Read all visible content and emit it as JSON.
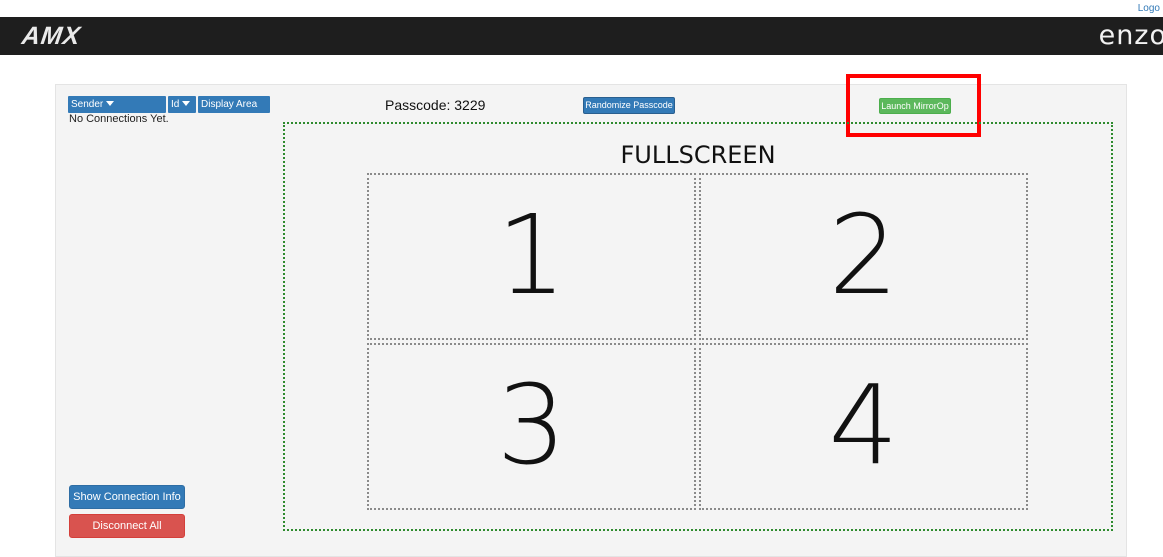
{
  "header": {
    "logout_label": "Logo",
    "left_logo": "AMX",
    "right_logo": "enzo",
    "bar_color": "#1e1e1e"
  },
  "connections": {
    "columns": [
      {
        "label": "Sender",
        "sortable": true
      },
      {
        "label": "Id",
        "sortable": true
      },
      {
        "label": "Display Area",
        "sortable": false
      }
    ],
    "empty_message": "No Connections Yet."
  },
  "passcode": {
    "label": "Passcode: 3229"
  },
  "toolbar": {
    "randomize_label": "Randomize Passcode",
    "launch_label": "Launch MirrorOp"
  },
  "layout_area": {
    "fullscreen_label": "FULLSCREEN",
    "quadrants": [
      "1",
      "2",
      "3",
      "4"
    ]
  },
  "actions": {
    "show_info_label": "Show Connection Info",
    "disconnect_label": "Disconnect All"
  },
  "colors": {
    "primary": "#337ab7",
    "success": "#5cb85c",
    "danger": "#d9534f",
    "highlight": "#ff0000",
    "fullscreen_border": "#2e8b2e"
  },
  "icons": {
    "sort_caret": "caret-down-icon"
  }
}
